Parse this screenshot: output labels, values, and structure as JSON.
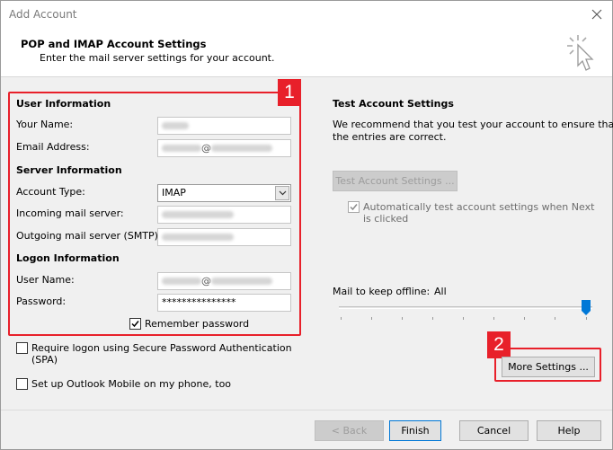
{
  "window": {
    "title": "Add Account"
  },
  "header": {
    "title": "POP and IMAP Account Settings",
    "subtitle": "Enter the mail server settings for your account."
  },
  "user_info": {
    "heading": "User Information",
    "your_name_label": "Your Name:",
    "email_label": "Email Address:",
    "email_at": "@"
  },
  "server_info": {
    "heading": "Server Information",
    "account_type_label": "Account Type:",
    "account_type_value": "IMAP",
    "incoming_label": "Incoming mail server:",
    "outgoing_label": "Outgoing mail server (SMTP):"
  },
  "logon_info": {
    "heading": "Logon Information",
    "username_label": "User Name:",
    "username_at": "@",
    "password_label": "Password:",
    "password_value": "***************",
    "remember_label": "Remember password",
    "remember_checked": true
  },
  "spa": {
    "label_line1": "Require logon using Secure Password Authentication",
    "label_line2": "(SPA)",
    "checked": false
  },
  "outlook_mobile": {
    "label": "Set up Outlook Mobile on my phone, too",
    "checked": false
  },
  "test_settings": {
    "heading": "Test Account Settings",
    "description_line1": "We recommend that you test your account to ensure that",
    "description_line2": "the entries are correct.",
    "button_label": "Test Account Settings ...",
    "auto_test_line1": "Automatically test account settings when Next",
    "auto_test_line2": "is clicked",
    "auto_test_checked": true
  },
  "offline": {
    "label": "Mail to keep offline:",
    "value": "All"
  },
  "buttons": {
    "more_settings": "More Settings ...",
    "back": "< Back",
    "finish": "Finish",
    "cancel": "Cancel",
    "help": "Help"
  },
  "annotations": {
    "badge1": "1",
    "badge2": "2"
  },
  "colors": {
    "highlight": "#e8202a",
    "slider_thumb": "#0078d7"
  }
}
